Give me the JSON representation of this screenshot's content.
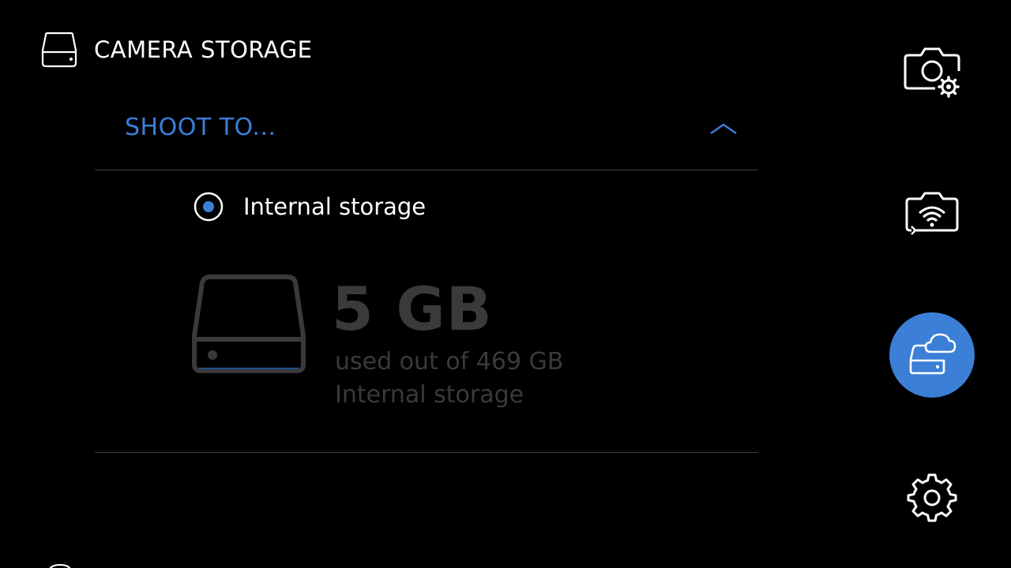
{
  "header": {
    "title": "CAMERA STORAGE",
    "icon": "drive-icon"
  },
  "section": {
    "title": "SHOOT TO...",
    "expanded": true,
    "icon": "chevron-up-icon",
    "accent_color": "#3b7fd6"
  },
  "option": {
    "label": "Internal storage",
    "selected": true
  },
  "storage": {
    "used": "5 GB",
    "used_of": "used out of 469 GB",
    "location": "Internal storage",
    "used_fraction": 0.0107,
    "icon": "drive-icon"
  },
  "nav": {
    "items": [
      {
        "name": "camera-settings",
        "icon": "camera-gear-icon",
        "active": false
      },
      {
        "name": "camera-wifi",
        "icon": "camera-wifi-icon",
        "active": false
      },
      {
        "name": "camera-storage",
        "icon": "cloud-drive-icon",
        "active": true
      },
      {
        "name": "settings",
        "icon": "gear-icon",
        "active": false
      }
    ],
    "active_color": "#3b7fd6"
  }
}
